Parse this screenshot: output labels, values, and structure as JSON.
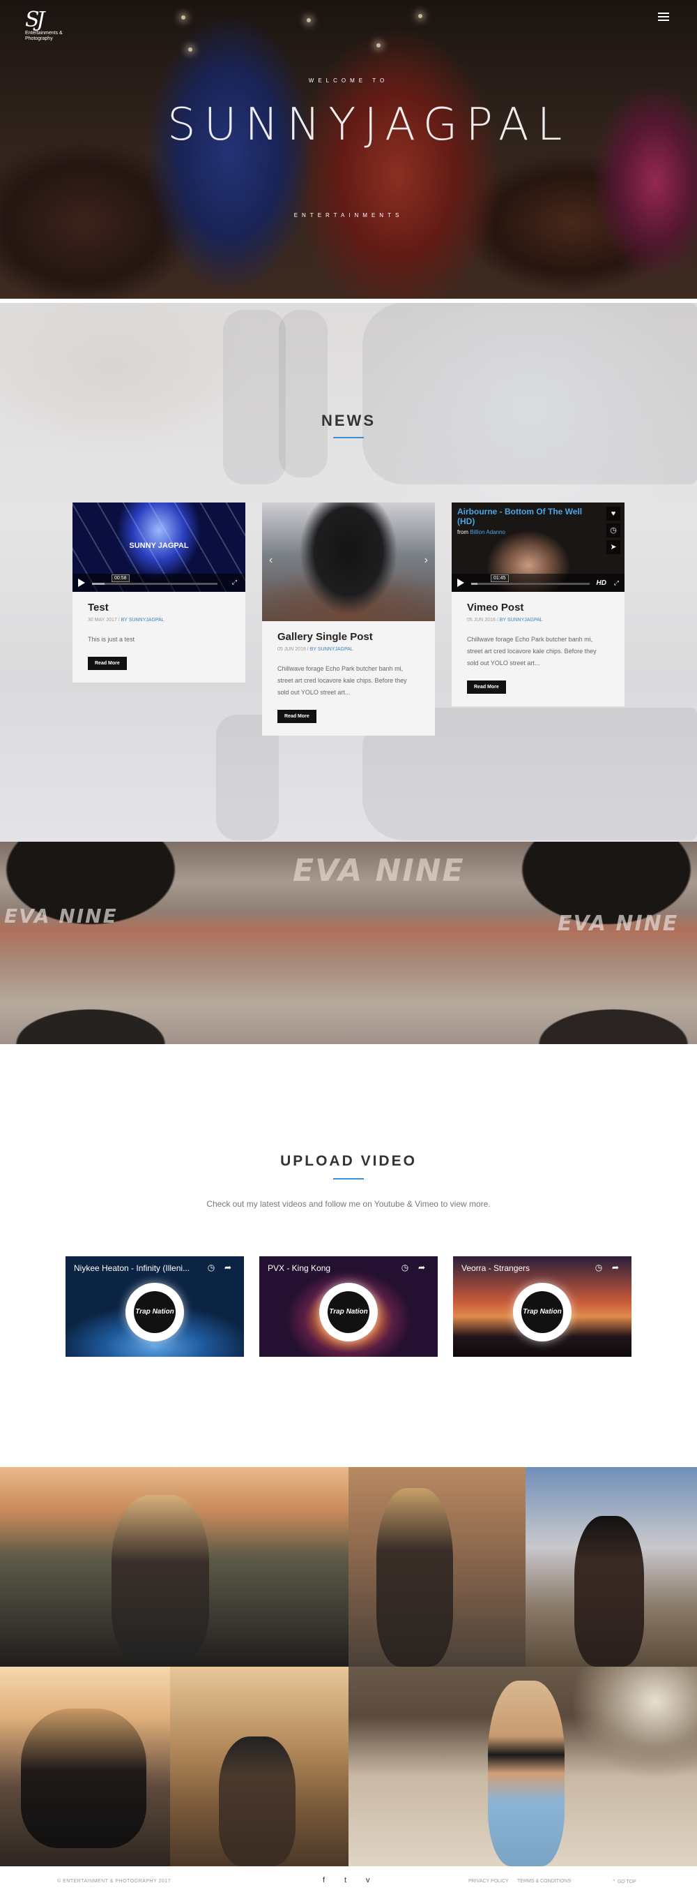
{
  "header": {
    "logo_mark": "SJ",
    "logo_tagline": "Entertainments & Photography",
    "menu_icon": "hamburger-menu-icon"
  },
  "hero": {
    "welcome": "WELCOME TO",
    "title": "SUNNYJAGPAL",
    "subtitle": "ENTERTAINMENTS"
  },
  "news": {
    "heading": "NEWS",
    "accent_color": "#3b8fd4",
    "read_more_label": "Read More",
    "posts": [
      {
        "title": "Test",
        "date": "30 MAY 2017",
        "author": "BY SUNNYJAGPAL",
        "excerpt": "This is just a test",
        "media": {
          "label": "SUNNY JAGPAL",
          "time": "00:58",
          "progress": 0.1
        }
      },
      {
        "title": "Gallery Single Post",
        "date": "05 JUN 2016",
        "author": "BY SUNNYJAGPAL",
        "excerpt": "Chillwave forage Echo Park butcher banh mi, street art cred locavore kale chips. Before they sold out YOLO street art..."
      },
      {
        "title": "Vimeo Post",
        "date": "05 JUN 2016",
        "author": "BY SUNNYJAGPAL",
        "excerpt": "Chillwave forage Echo Park butcher banh mi, street art cred locavore kale chips. Before they sold out YOLO street art...",
        "media": {
          "video_title": "Airbourne - Bottom Of The Well (HD)",
          "from_label": "from",
          "channel": "Billion Adanno",
          "time": "01:45",
          "hd": "HD",
          "progress": 0.05
        }
      }
    ]
  },
  "brick": {
    "graffiti_top": "EVA NINE",
    "graffiti_left": "EVA NINE",
    "graffiti_right": "EVA NINE"
  },
  "upload": {
    "heading": "UPLOAD VIDEO",
    "subtitle": "Check out my latest videos and follow me on Youtube & Vimeo to view more.",
    "disc_label": "Trap Nation",
    "videos": [
      {
        "title": "Niykee Heaton - Infinity (Illeni..."
      },
      {
        "title": "PVX - King Kong"
      },
      {
        "title": "Veorra - Strangers"
      }
    ]
  },
  "footer": {
    "copyright": "© ENTERTAINMENT & PHOTOGRAPHY 2017",
    "social": [
      "f",
      "t",
      "v"
    ],
    "privacy": "PRIVACY POLICY",
    "terms": "TERMS & CONDITIONS",
    "go_top": "GO TOP"
  }
}
